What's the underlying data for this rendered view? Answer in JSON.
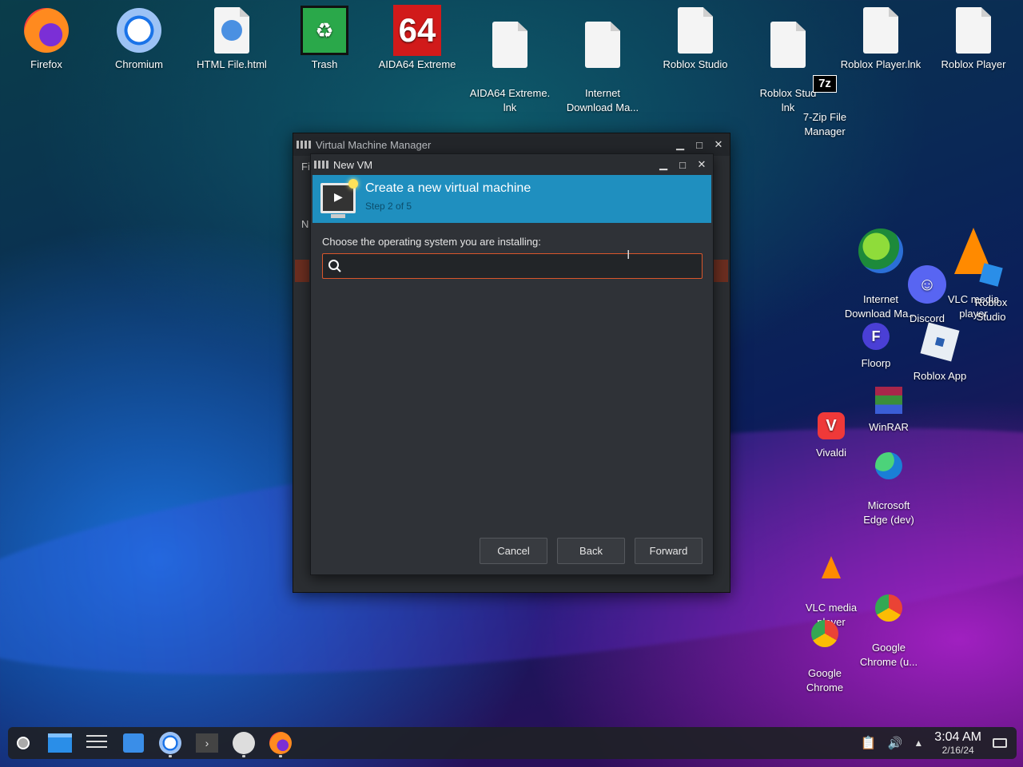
{
  "desktop_icons": {
    "firefox": "Firefox",
    "chromium": "Chromium",
    "html_file": "HTML File.html",
    "trash": "Trash",
    "aida64": "AIDA64 Extreme",
    "aida64_lnk": "AIDA64 Extreme.\nlnk",
    "idm_file": "Internet\nDownload Ma...",
    "roblox_studio_file": "Roblox Studio",
    "roblox_studio_lnk": "Roblox Stud\nlnk",
    "roblox_player_lnk": "Roblox Player.lnk",
    "roblox_player": "Roblox Player",
    "seven_zip": "7-Zip File\nManager",
    "idm": "Internet\nDownload Ma...",
    "discord": "Discord",
    "vlc_top": "VLC media\nplayer",
    "roblox_studio": "Roblox\nStudio",
    "floorp": "Floorp",
    "roblox_app": "Roblox App",
    "winrar": "WinRAR",
    "vivaldi": "Vivaldi",
    "edge_dev": "Microsoft\nEdge (dev)",
    "vlc": "VLC media\nplayer",
    "chrome_u": "Google\nChrome (u...",
    "chrome": "Google\nChrome",
    "aida_badge": "64",
    "seven_zip_badge": "7z"
  },
  "vmm": {
    "title": "Virtual Machine Manager",
    "menu_stub": "Fi",
    "col_stub": "N"
  },
  "newvm": {
    "title": "New VM",
    "header_title": "Create a new virtual machine",
    "header_step": "Step 2 of 5",
    "prompt": "Choose the operating system you are installing:",
    "search_value": "",
    "buttons": {
      "cancel": "Cancel",
      "back": "Back",
      "forward": "Forward"
    }
  },
  "taskbar": {
    "time": "3:04 AM",
    "date": "2/16/24"
  },
  "colors": {
    "accent": "#1f8fbf",
    "search_border": "#d9562b"
  }
}
